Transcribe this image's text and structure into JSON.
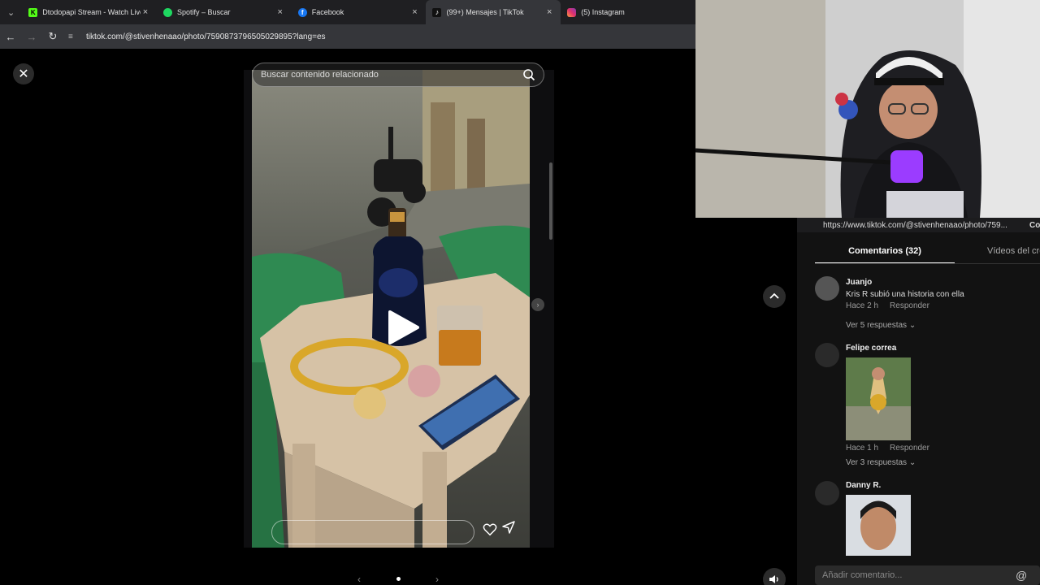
{
  "browser": {
    "tabs": [
      {
        "title": "Dtodopapi Stream - Watch Live",
        "icon": "kick-icon",
        "color": "#53fc18",
        "active": false
      },
      {
        "title": "Spotify – Buscar",
        "icon": "spotify-icon",
        "color": "#1ed760",
        "active": false
      },
      {
        "title": "Facebook",
        "icon": "facebook-icon",
        "color": "#1877f2",
        "active": false
      },
      {
        "title": "(99+) Mensajes | TikTok",
        "icon": "tiktok-icon",
        "color": "#000000",
        "active": true
      },
      {
        "title": "(5) Instagram",
        "icon": "instagram-icon",
        "color": "#e1306c",
        "active": false
      }
    ],
    "url": "tiktok.com/@stivenhenaao/photo/7590873796505029895?lang=es"
  },
  "viewer": {
    "search_placeholder": "Buscar contenido relacionado",
    "page_count": 1
  },
  "panel": {
    "share_link": "https://www.tiktok.com/@stivenhenaao/photo/759...",
    "copy_label": "Co",
    "tabs": {
      "comments": "Comentarios (32)",
      "creator_videos": "Vídeos del cre"
    },
    "comments": [
      {
        "author": "Juanjo",
        "text": "Kris R subió una historia con ella",
        "time": "Hace 2 h",
        "reply": "Responder",
        "replies": "Ver 5 respuestas"
      },
      {
        "author": "Felipe correa",
        "time": "Hace 1 h",
        "reply": "Responder",
        "replies": "Ver 3 respuestas"
      },
      {
        "author": "Danny R."
      }
    ],
    "add_comment_placeholder": "Añadir comentario...",
    "mention_symbol": "@"
  },
  "colors": {
    "background": "#000000",
    "panel": "#121212",
    "chrome": "#35363a"
  }
}
